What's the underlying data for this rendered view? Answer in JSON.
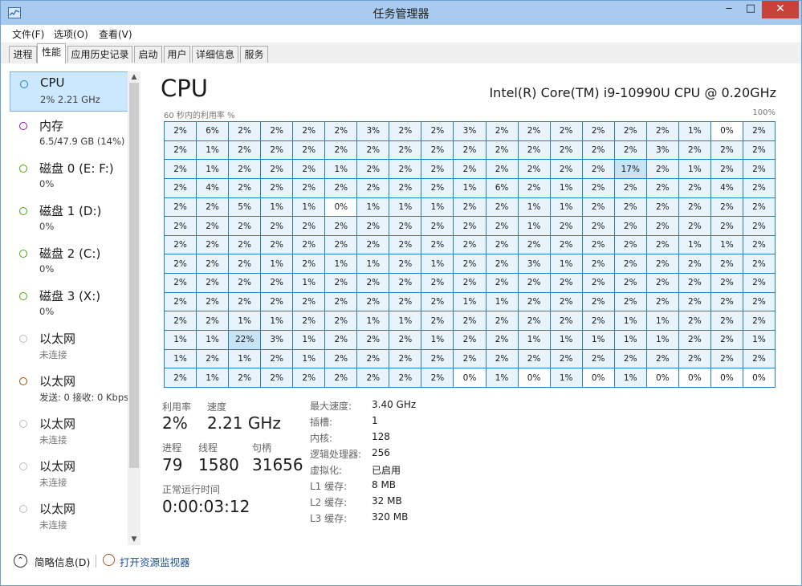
{
  "window": {
    "title": "任务管理器",
    "min_label": "‒",
    "max_label": "□",
    "close_label": "✕"
  },
  "menu": [
    "文件(F)",
    "选项(O)",
    "查看(V)"
  ],
  "tabs": [
    "进程",
    "性能",
    "应用历史记录",
    "启动",
    "用户",
    "详细信息",
    "服务"
  ],
  "active_tab": "性能",
  "sidebar": {
    "items": [
      {
        "name": "CPU",
        "sub": "2% 2.21 GHz",
        "color": "#1f80bf",
        "selected": true
      },
      {
        "name": "内存",
        "sub": "6.5/47.9 GB (14%)",
        "color": "#8b12ae"
      },
      {
        "name": "磁盘 0 (E: F:)",
        "sub": "0%",
        "color": "#4da60c"
      },
      {
        "name": "磁盘 1 (D:)",
        "sub": "0%",
        "color": "#4da60c"
      },
      {
        "name": "磁盘 2 (C:)",
        "sub": "0%",
        "color": "#4da60c"
      },
      {
        "name": "磁盘 3 (X:)",
        "sub": "0%",
        "color": "#4da60c"
      },
      {
        "name": "以太网",
        "sub": "未连接",
        "color": "#bcbcbc"
      },
      {
        "name": "以太网",
        "sub": "发送: 0 接收: 0 Kbps",
        "color": "#a74f01"
      },
      {
        "name": "以太网",
        "sub": "未连接",
        "color": "#bcbcbc"
      },
      {
        "name": "以太网",
        "sub": "未连接",
        "color": "#bcbcbc"
      },
      {
        "name": "以太网",
        "sub": "未连接",
        "color": "#bcbcbc"
      }
    ],
    "scroll_up": "▲",
    "scroll_down": "▼"
  },
  "main": {
    "title": "CPU",
    "model": "Intel(R) Core(TM) i9-10990U CPU @ 0.20GHz",
    "graph_left": "60 秒内的利用率 %",
    "graph_right": "100%",
    "cores": [
      [
        "2%",
        "6%",
        "2%",
        "2%",
        "2%",
        "2%",
        "3%",
        "2%",
        "2%",
        "3%",
        "2%",
        "2%",
        "2%",
        "2%",
        "2%",
        "2%",
        "1%",
        "0%",
        "2%"
      ],
      [
        "2%",
        "1%",
        "2%",
        "2%",
        "2%",
        "2%",
        "2%",
        "2%",
        "2%",
        "2%",
        "2%",
        "2%",
        "2%",
        "2%",
        "2%",
        "3%",
        "2%",
        "2%",
        "2%"
      ],
      [
        "2%",
        "1%",
        "2%",
        "2%",
        "2%",
        "1%",
        "2%",
        "2%",
        "2%",
        "2%",
        "2%",
        "2%",
        "2%",
        "2%",
        "17%",
        "2%",
        "1%",
        "2%",
        "2%"
      ],
      [
        "2%",
        "4%",
        "2%",
        "2%",
        "2%",
        "2%",
        "2%",
        "2%",
        "2%",
        "1%",
        "6%",
        "2%",
        "1%",
        "2%",
        "2%",
        "2%",
        "2%",
        "4%",
        "2%"
      ],
      [
        "2%",
        "2%",
        "5%",
        "1%",
        "1%",
        "0%",
        "1%",
        "1%",
        "1%",
        "2%",
        "2%",
        "1%",
        "1%",
        "2%",
        "2%",
        "2%",
        "2%",
        "2%",
        "2%"
      ],
      [
        "2%",
        "2%",
        "2%",
        "2%",
        "2%",
        "2%",
        "2%",
        "2%",
        "2%",
        "2%",
        "2%",
        "1%",
        "2%",
        "2%",
        "2%",
        "2%",
        "2%",
        "2%",
        "2%"
      ],
      [
        "2%",
        "2%",
        "2%",
        "2%",
        "2%",
        "2%",
        "2%",
        "2%",
        "2%",
        "2%",
        "2%",
        "2%",
        "2%",
        "2%",
        "2%",
        "2%",
        "1%",
        "1%",
        "2%"
      ],
      [
        "2%",
        "2%",
        "2%",
        "1%",
        "2%",
        "1%",
        "1%",
        "2%",
        "1%",
        "2%",
        "2%",
        "3%",
        "1%",
        "2%",
        "2%",
        "2%",
        "2%",
        "2%",
        "2%"
      ],
      [
        "2%",
        "2%",
        "2%",
        "2%",
        "1%",
        "2%",
        "2%",
        "2%",
        "2%",
        "2%",
        "2%",
        "2%",
        "2%",
        "2%",
        "2%",
        "2%",
        "2%",
        "2%",
        "2%"
      ],
      [
        "2%",
        "2%",
        "2%",
        "2%",
        "2%",
        "2%",
        "2%",
        "2%",
        "2%",
        "1%",
        "1%",
        "2%",
        "2%",
        "2%",
        "2%",
        "2%",
        "2%",
        "2%",
        "2%"
      ],
      [
        "2%",
        "2%",
        "1%",
        "1%",
        "2%",
        "2%",
        "1%",
        "1%",
        "2%",
        "2%",
        "2%",
        "2%",
        "2%",
        "2%",
        "1%",
        "1%",
        "2%",
        "2%",
        "2%"
      ],
      [
        "1%",
        "1%",
        "22%",
        "3%",
        "1%",
        "2%",
        "2%",
        "2%",
        "1%",
        "2%",
        "2%",
        "1%",
        "1%",
        "1%",
        "1%",
        "1%",
        "2%",
        "2%",
        "1%"
      ],
      [
        "1%",
        "2%",
        "1%",
        "2%",
        "1%",
        "2%",
        "2%",
        "2%",
        "2%",
        "2%",
        "2%",
        "2%",
        "2%",
        "2%",
        "2%",
        "2%",
        "2%",
        "2%",
        "2%"
      ],
      [
        "2%",
        "1%",
        "2%",
        "2%",
        "2%",
        "2%",
        "2%",
        "2%",
        "2%",
        "0%",
        "1%",
        "0%",
        "1%",
        "0%",
        "1%",
        "0%",
        "0%",
        "0%",
        "0%"
      ]
    ],
    "stats": {
      "util_label": "利用率",
      "util": "2%",
      "speed_label": "速度",
      "speed": "2.21 GHz",
      "proc_label": "进程",
      "proc": "79",
      "thread_label": "线程",
      "thread": "1580",
      "handle_label": "句柄",
      "handle": "31656",
      "uptime_label": "正常运行时间",
      "uptime": "0:00:03:12"
    },
    "details": [
      {
        "k": "最大速度:",
        "v": "3.40 GHz"
      },
      {
        "k": "插槽:",
        "v": "1"
      },
      {
        "k": "内核:",
        "v": "128"
      },
      {
        "k": "逻辑处理器:",
        "v": "256"
      },
      {
        "k": "虚拟化:",
        "v": "已启用"
      },
      {
        "k": "L1 缓存:",
        "v": "8 MB"
      },
      {
        "k": "L2 缓存:",
        "v": "32 MB"
      },
      {
        "k": "L3 缓存:",
        "v": "320 MB"
      }
    ]
  },
  "footer": {
    "fewer": "简略信息(D)",
    "monitor": "打开资源监视器"
  }
}
